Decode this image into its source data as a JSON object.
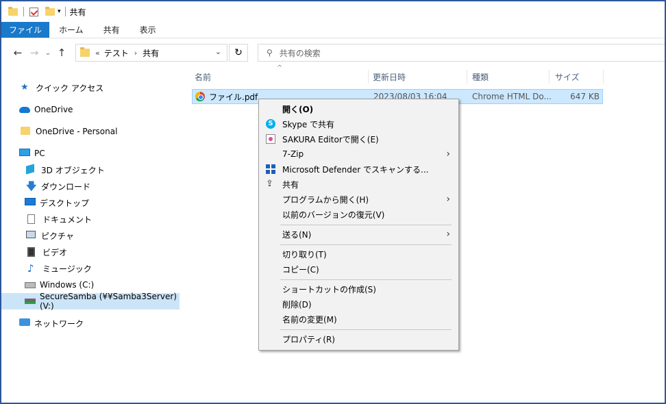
{
  "window": {
    "title": "共有"
  },
  "ribbon": {
    "tabs": [
      {
        "label": "ファイル"
      },
      {
        "label": "ホーム"
      },
      {
        "label": "共有"
      },
      {
        "label": "表示"
      }
    ]
  },
  "nav": {
    "back": "←",
    "forward": "→",
    "recent": "⌄",
    "up": "↑",
    "breadcrumb_prefix": "«",
    "breadcrumb": [
      "テスト",
      "共有"
    ],
    "breadcrumb_sep": "›",
    "dropdown": "⌄",
    "refresh": "↻",
    "search_icon": "⚲",
    "search_placeholder": "共有の検索"
  },
  "sidebar": {
    "items": [
      {
        "label": "クイック アクセス",
        "icon": "star-icon"
      },
      {
        "label": "OneDrive",
        "icon": "cloud-icon"
      },
      {
        "label": "OneDrive - Personal",
        "icon": "folder-icon"
      },
      {
        "label": "PC",
        "icon": "pc-icon"
      },
      {
        "label": "3D オブジェクト",
        "icon": "3d-objects-icon"
      },
      {
        "label": "ダウンロード",
        "icon": "download-icon"
      },
      {
        "label": "デスクトップ",
        "icon": "desktop-icon"
      },
      {
        "label": "ドキュメント",
        "icon": "document-icon"
      },
      {
        "label": "ピクチャ",
        "icon": "picture-icon"
      },
      {
        "label": "ビデオ",
        "icon": "video-icon"
      },
      {
        "label": "ミュージック",
        "icon": "music-icon"
      },
      {
        "label": "Windows (C:)",
        "icon": "drive-icon"
      },
      {
        "label": "SecureSamba (¥¥Samba3Server) (V:)",
        "icon": "network-drive-icon",
        "selected": true
      },
      {
        "label": "ネットワーク",
        "icon": "network-icon"
      }
    ]
  },
  "list": {
    "columns": [
      "名前",
      "更新日時",
      "種類",
      "サイズ"
    ],
    "sort_caret": "^",
    "files": [
      {
        "name": "ファイル.pdf",
        "modified": "2023/08/03 16:04",
        "type": "Chrome HTML Do...",
        "size": "647 KB"
      }
    ]
  },
  "context_menu": {
    "items": [
      {
        "label": "開く(O)",
        "bold": true
      },
      {
        "label": "Skype で共有",
        "icon": "skype-icon"
      },
      {
        "label": "SAKURA Editorで開く(E)",
        "icon": "sakura-editor-icon"
      },
      {
        "label": "7-Zip",
        "submenu": true
      },
      {
        "label": "Microsoft Defender でスキャンする...",
        "icon": "defender-icon"
      },
      {
        "label": "共有",
        "icon": "share-icon"
      },
      {
        "label": "プログラムから開く(H)",
        "submenu": true
      },
      {
        "label": "以前のバージョンの復元(V)"
      },
      {
        "label": "送る(N)",
        "submenu": true
      },
      {
        "label": "切り取り(T)"
      },
      {
        "label": "コピー(C)"
      },
      {
        "label": "ショートカットの作成(S)"
      },
      {
        "label": "削除(D)"
      },
      {
        "label": "名前の変更(M)"
      },
      {
        "label": "プロパティ(R)"
      }
    ],
    "submenu_arrow": "›",
    "skype_letter": "S",
    "share_glyph": "⇪"
  },
  "colors": {
    "accent": "#1979ca",
    "selection": "#cce8ff",
    "window_border": "#2b579a"
  }
}
